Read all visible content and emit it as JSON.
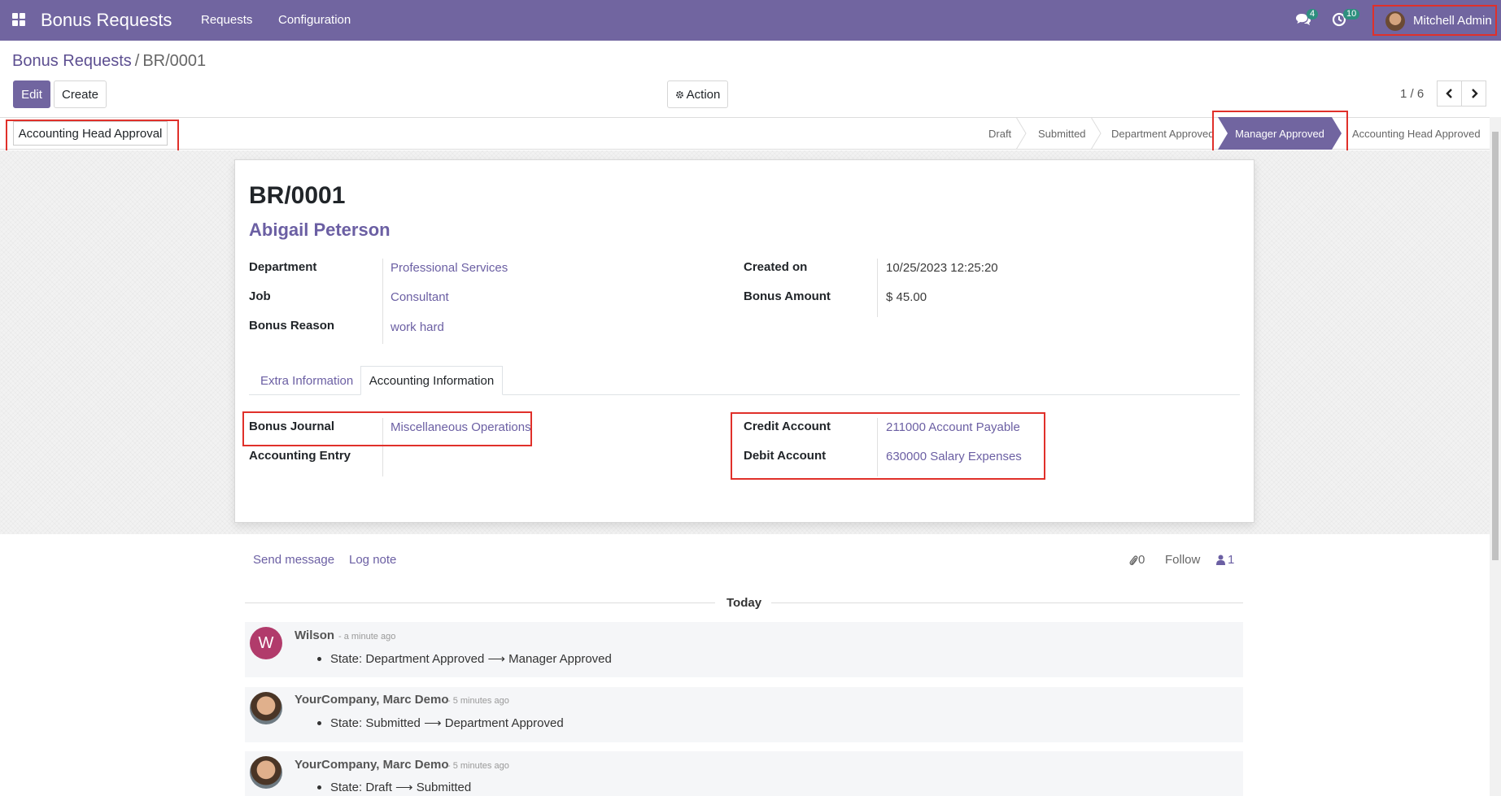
{
  "navbar": {
    "app_title": "Bonus Requests",
    "menu_items": [
      "Requests",
      "Configuration"
    ],
    "messages_badge": "4",
    "activities_badge": "10",
    "user_name": "Mitchell Admin",
    "bg_color": "#7165a0"
  },
  "breadcrumb": {
    "parent": "Bonus Requests",
    "separator": "/",
    "current": "BR/0001"
  },
  "control_panel": {
    "edit_label": "Edit",
    "create_label": "Create",
    "action_label": "Action",
    "pager_value": "1 / 6"
  },
  "statusbar": {
    "header_button": "Accounting Head Approval",
    "stages": [
      "Draft",
      "Submitted",
      "Department Approved",
      "Manager Approved",
      "Accounting Head Approved"
    ],
    "active_stage": "Manager Approved"
  },
  "record": {
    "name": "BR/0001",
    "employee": "Abigail Peterson",
    "department_label": "Department",
    "department": "Professional Services",
    "job_label": "Job",
    "job": "Consultant",
    "reason_label": "Bonus Reason",
    "reason": "work hard",
    "created_on_label": "Created on",
    "created_on": "10/25/2023 12:25:20",
    "amount_label": "Bonus Amount",
    "amount": "$ 45.00"
  },
  "tabs": {
    "extra": "Extra Information",
    "accounting": "Accounting Information",
    "active": "Accounting Information"
  },
  "accounting": {
    "journal_label": "Bonus Journal",
    "journal": "Miscellaneous Operations",
    "entry_label": "Accounting Entry",
    "entry": "",
    "credit_label": "Credit Account",
    "credit": "211000 Account Payable",
    "debit_label": "Debit Account",
    "debit": "630000 Salary Expenses"
  },
  "chatter": {
    "send_message": "Send message",
    "log_note": "Log note",
    "attachments": "0",
    "follow": "Follow",
    "followers": "1",
    "day": "Today",
    "messages": [
      {
        "avatar_letter": "W",
        "author": "Wilson",
        "time": "- a minute ago",
        "body": "State: Department Approved ⟶ Manager Approved"
      },
      {
        "author": "YourCompany, Marc Demo",
        "time": "- 5 minutes ago",
        "body": "State: Submitted ⟶ Department Approved"
      },
      {
        "author": "YourCompany, Marc Demo",
        "time": "- 5 minutes ago",
        "body": "State: Draft ⟶ Submitted"
      }
    ]
  }
}
